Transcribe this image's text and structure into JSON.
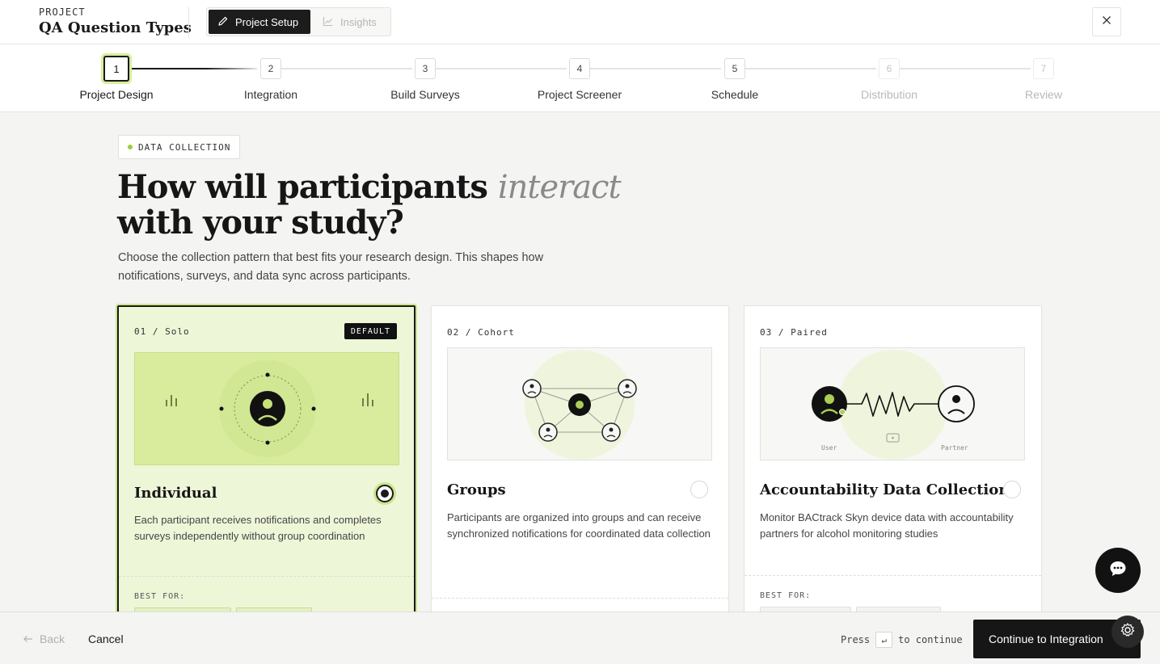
{
  "header": {
    "project_label": "PROJECT",
    "project_name": "QA Question Types",
    "tabs": [
      {
        "label": "Project Setup",
        "icon": "pencil-icon",
        "active": true
      },
      {
        "label": "Insights",
        "icon": "chart-icon",
        "active": false
      }
    ],
    "close_icon": "close-icon"
  },
  "stepper": {
    "steps": [
      {
        "number": "1",
        "label": "Project Design",
        "state": "current"
      },
      {
        "number": "2",
        "label": "Integration",
        "state": "pending"
      },
      {
        "number": "3",
        "label": "Build Surveys",
        "state": "pending"
      },
      {
        "number": "4",
        "label": "Project Screener",
        "state": "pending"
      },
      {
        "number": "5",
        "label": "Schedule",
        "state": "pending"
      },
      {
        "number": "6",
        "label": "Distribution",
        "state": "disabled"
      },
      {
        "number": "7",
        "label": "Review",
        "state": "disabled"
      }
    ]
  },
  "main": {
    "section_tag": "DATA COLLECTION",
    "headline_before": "How will participants ",
    "headline_em": "interact",
    "headline_after": " with your study?",
    "subtitle": "Choose the collection pattern that best fits your research design. This shapes how notifications, surveys, and data sync across participants.",
    "cards": [
      {
        "code": "01 / Solo",
        "badge": "DEFAULT",
        "title": "Individual",
        "description": "Each participant receives notifications and completes surveys independently without group coordination",
        "best_for_label": "BEST FOR:",
        "selected": true
      },
      {
        "code": "02 / Cohort",
        "title": "Groups",
        "description": "Participants are organized into groups and can receive synchronized notifications for coordinated data collection",
        "selected": false
      },
      {
        "code": "03 / Paired",
        "title": "Accountability Data Collection",
        "description": "Monitor BACtrack Skyn device data with accountability partners for alcohol monitoring studies",
        "best_for_label": "BEST FOR:",
        "illus_left_label": "User",
        "illus_right_label": "Partner",
        "selected": false
      }
    ]
  },
  "footer": {
    "back_label": "Back",
    "cancel_label": "Cancel",
    "press_label": "Press",
    "key": "↵",
    "continue_hint": "to continue",
    "continue_button": "Continue to Integration"
  },
  "colors": {
    "accent": "#c9e68a",
    "selected_bg": "#eef6d8",
    "dark": "#161616"
  }
}
